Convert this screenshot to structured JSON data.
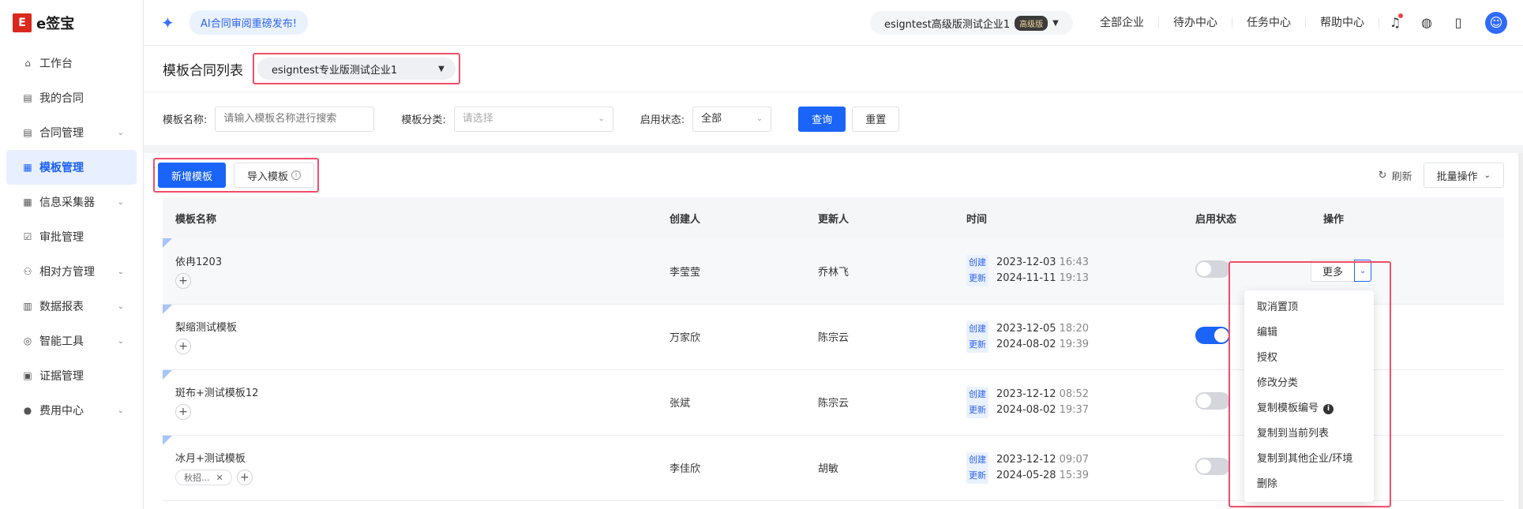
{
  "brand": {
    "logo_mark": "E",
    "name": "e签宝"
  },
  "sidebar": {
    "items": [
      {
        "label": "工作台",
        "icon": "home-icon",
        "glyph": "⌂",
        "has_children": false,
        "active": false
      },
      {
        "label": "我的合同",
        "icon": "contract-icon",
        "glyph": "▤",
        "has_children": false,
        "active": false
      },
      {
        "label": "合同管理",
        "icon": "document-icon",
        "glyph": "▤",
        "has_children": true,
        "active": false
      },
      {
        "label": "模板管理",
        "icon": "template-icon",
        "glyph": "▦",
        "has_children": false,
        "active": true
      },
      {
        "label": "信息采集器",
        "icon": "grid-icon",
        "glyph": "▦",
        "has_children": true,
        "active": false
      },
      {
        "label": "审批管理",
        "icon": "approval-icon",
        "glyph": "☑",
        "has_children": false,
        "active": false
      },
      {
        "label": "相对方管理",
        "icon": "counterparty-icon",
        "glyph": "⚇",
        "has_children": true,
        "active": false
      },
      {
        "label": "数据报表",
        "icon": "report-icon",
        "glyph": "▥",
        "has_children": true,
        "active": false
      },
      {
        "label": "智能工具",
        "icon": "ai-tool-icon",
        "glyph": "◎",
        "has_children": true,
        "active": false
      },
      {
        "label": "证据管理",
        "icon": "evidence-icon",
        "glyph": "▣",
        "has_children": false,
        "active": false
      },
      {
        "label": "费用中心",
        "icon": "billing-icon",
        "glyph": "●",
        "has_children": true,
        "active": false
      }
    ]
  },
  "topbar": {
    "ai_announcement": "AI合同审阅重磅发布!",
    "org_name": "esigntest高级版测试企业1",
    "version_tag": "高级版",
    "links": [
      "全部企业",
      "待办中心",
      "任务中心",
      "帮助中心"
    ]
  },
  "header": {
    "title": "模板合同列表",
    "enterprise_select": "esigntest专业版测试企业1"
  },
  "filters": {
    "name_label": "模板名称:",
    "name_placeholder": "请输入模板名称进行搜索",
    "category_label": "模板分类:",
    "category_placeholder": "请选择",
    "status_label": "启用状态:",
    "status_value": "全部",
    "search_button": "查询",
    "reset_button": "重置"
  },
  "toolbar": {
    "add_template": "新增模板",
    "import_template": "导入模板",
    "refresh": "刷新",
    "batch_ops": "批量操作"
  },
  "table": {
    "columns": [
      "模板名称",
      "创建人",
      "更新人",
      "时间",
      "启用状态",
      "操作"
    ],
    "created_tag": "创建",
    "updated_tag": "更新",
    "more_button": "更多",
    "rows": [
      {
        "name": "依冉1203",
        "creator": "李莹莹",
        "updater": "乔林飞",
        "created_date": "2023-12-03",
        "created_time": "16:43",
        "updated_date": "2024-11-11",
        "updated_time": "19:13",
        "enabled": false,
        "tag": ""
      },
      {
        "name": "梨缩测试模板",
        "creator": "万家欣",
        "updater": "陈宗云",
        "created_date": "2023-12-05",
        "created_time": "18:20",
        "updated_date": "2024-08-02",
        "updated_time": "19:39",
        "enabled": true,
        "tag": ""
      },
      {
        "name": "斑布+测试模板12",
        "creator": "张斌",
        "updater": "陈宗云",
        "created_date": "2023-12-12",
        "created_time": "08:52",
        "updated_date": "2024-08-02",
        "updated_time": "19:37",
        "enabled": false,
        "tag": ""
      },
      {
        "name": "冰月+测试模板",
        "creator": "李佳欣",
        "updater": "胡敏",
        "created_date": "2023-12-12",
        "created_time": "09:07",
        "updated_date": "2024-05-28",
        "updated_time": "15:39",
        "enabled": false,
        "tag": "秋招..."
      }
    ]
  },
  "more_menu": {
    "items": [
      "取消置顶",
      "编辑",
      "授权",
      "修改分类",
      "复制模板编号",
      "复制到当前列表",
      "复制到其他企业/环境",
      "删除"
    ]
  },
  "colors": {
    "primary": "#1a64f7",
    "highlight_border": "#f04e6a"
  }
}
